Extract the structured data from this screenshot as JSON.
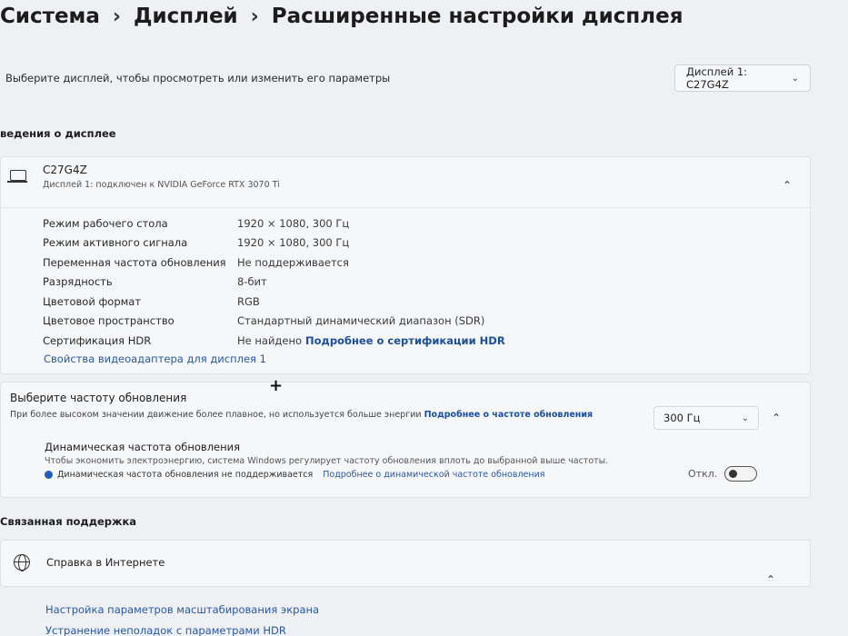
{
  "breadcrumb": {
    "items": [
      "Система",
      "Дисплей",
      "Расширенные настройки дисплея"
    ],
    "separator": "›"
  },
  "display_select": {
    "prompt": "Выберите дисплей, чтобы просмотреть или изменить его параметры",
    "selected": "Дисплей 1: C27G4Z"
  },
  "display_info": {
    "section_title": "ведения о дисплее",
    "monitor_name": "C27G4Z",
    "monitor_subtitle": "Дисплей 1: подключен к NVIDIA GeForce RTX 3070 Ti",
    "properties": [
      {
        "label": "Режим рабочего стола",
        "value": "1920 × 1080, 300 Гц"
      },
      {
        "label": "Режим активного сигнала",
        "value": "1920 × 1080, 300 Гц"
      },
      {
        "label": "Переменная частота обновления",
        "value": "Не поддерживается"
      },
      {
        "label": "Разрядность",
        "value": "8-бит"
      },
      {
        "label": "Цветовой формат",
        "value": "RGB"
      },
      {
        "label": "Цветовое пространство",
        "value": "Стандартный динамический диапазон (SDR)"
      },
      {
        "label": "Сертификация HDR",
        "value": "Не найдено",
        "link": "Подробнее о сертификации HDR"
      }
    ],
    "adapter_link": "Свойства видеоадаптера для дисплея 1"
  },
  "refresh": {
    "title": "Выберите частоту обновления",
    "description": "При более высоком значении движение более плавное, но используется больше энергии",
    "link": "Подробнее о частоте обновления",
    "rate_selected": "300 Гц",
    "dynamic_title": "Динамическая частота обновления",
    "dynamic_desc": "Чтобы экономить электроэнергию, система Windows регулирует частоту обновления вплоть до выбранной выше частоты.",
    "dynamic_warning": "Динамическая частота обновления не поддерживается",
    "dynamic_link": "Подробнее о динамической частоте обновления",
    "toggle_label": "Откл.",
    "toggle_on": false
  },
  "support": {
    "section_title": "Связанная поддержка",
    "help_label": "Справка в Интернете",
    "links": [
      "Настройка параметров масштабирования экрана",
      "Устранение неполадок с параметрами HDR"
    ]
  },
  "colors": {
    "background": "#eef0f4",
    "card": "#f6f7f9",
    "link": "#1a4fa0",
    "info_dot": "#1f5fbf"
  }
}
